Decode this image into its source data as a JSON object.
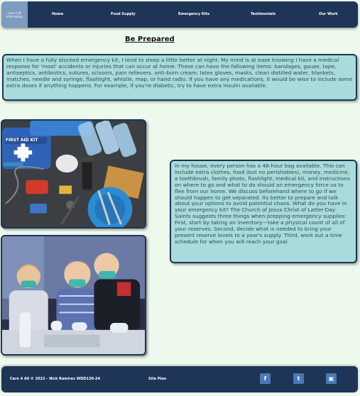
{
  "header": {
    "logo_line1": "Care 4 All",
    "logo_line2": "Information",
    "nav": [
      {
        "label": "Home"
      },
      {
        "label": "Food Supply"
      },
      {
        "label": "Emergency Kits"
      },
      {
        "label": "Testimonials"
      },
      {
        "label": "Our Work"
      }
    ]
  },
  "main": {
    "title": "Be Prepared",
    "paragraph_1": "When I have a fully stocked emergency kit, I tend to sleep a little better at night. My mind is at ease knowing I have a medical response for 'most' accidents or injuries that can occur at home. These can have the following items: bandages, gauze, tape, antiseptics, antibiotics, sutures, scissors, pain relievers, anti-burn cream, latex gloves, masks, clean distilled water, blankets, matches, needle and syringe, flashlight, whistle, map, or hand radio. If you have any medications, it would be wise to include some extra doses if anything happens. For example, if you're diabetic, try to have extra insulin available.",
    "paragraph_2": "In my house, every person has a 48-hour bag available. This can include extra clothes, food (but no perishables), money, medicine, a toothbrush, family photo, flashlight, medical kit, and instructions on where to go and what to do should an emergency force us to flee from our home. We discuss beforehand where to go if we should happen to get separated. Its better to prepare and talk about your options to avoid potential chaos. What do you have in your emergency kit? The Church of Jesus Christ of Latter-Day Saints suggests three things when prepping emergency supplies: First, start by taking an inventory—take a physical count of all of your reserves. Second, decide what is needed to bring your present reserve levels to a year's supply. Third, work out a time schedule for when you will reach your goal.",
    "photo_1_kit_label": "FIRST AID KIT"
  },
  "footer": {
    "copyright": "Care 4 All © 2022 - Nick Ramirez WDD130-24",
    "site_plan": "Site Plan",
    "social": [
      {
        "icon": "facebook-icon",
        "glyph": "f"
      },
      {
        "icon": "twitter-icon",
        "glyph": "t"
      },
      {
        "icon": "instagram-icon",
        "glyph": "▣"
      }
    ]
  },
  "colors": {
    "background": "#eef9ee",
    "nav_bg": "#1e3557",
    "box_bg": "#a8dcdc",
    "social_bg": "#4a79b8"
  }
}
